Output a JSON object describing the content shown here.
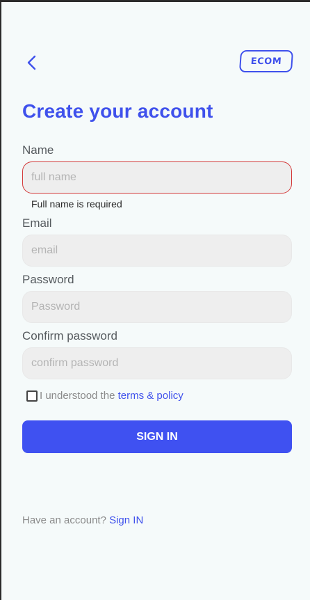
{
  "header": {
    "back_icon": "chevron-left-icon",
    "logo_text": "ECOM"
  },
  "title": "Create your account",
  "form": {
    "name": {
      "label": "Name",
      "placeholder": "full name",
      "value": "",
      "error": "Full name is required"
    },
    "email": {
      "label": "Email",
      "placeholder": "email",
      "value": ""
    },
    "password": {
      "label": "Password",
      "placeholder": "Password",
      "value": ""
    },
    "confirm_password": {
      "label": "Confirm password",
      "placeholder": "confirm password",
      "value": ""
    },
    "terms": {
      "checked": false,
      "text": "I understood the ",
      "link_text": "terms & policy"
    },
    "submit_label": "SIGN IN"
  },
  "footer": {
    "text": "Have an account? ",
    "link_text": "Sign IN"
  },
  "colors": {
    "accent": "#3f51ec",
    "button": "#3f51f1",
    "background": "#f5fafa",
    "input_bg": "#eeeeee",
    "error_border": "#d33a3a"
  }
}
